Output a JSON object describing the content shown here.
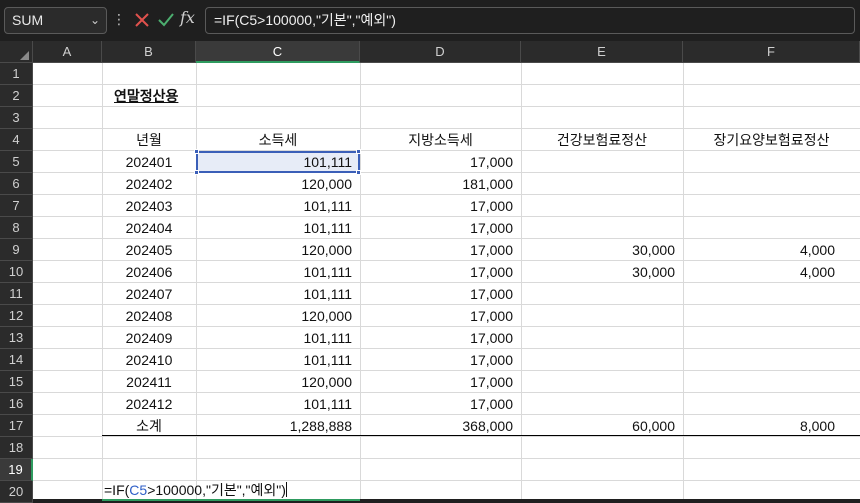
{
  "formula_bar": {
    "name_box": "SUM",
    "formula": "=IF(C5>100000,\"기본\",\"예외\")"
  },
  "columns": [
    "A",
    "B",
    "C",
    "D",
    "E",
    "F"
  ],
  "rows": [
    "1",
    "2",
    "3",
    "4",
    "5",
    "6",
    "7",
    "8",
    "9",
    "10",
    "11",
    "12",
    "13",
    "14",
    "15",
    "16",
    "17",
    "18",
    "19",
    "20"
  ],
  "sheet": {
    "title": "연말정산용",
    "headers": {
      "b": "년월",
      "c": "소득세",
      "d": "지방소득세",
      "e": "건강보험료정산",
      "f": "장기요양보험료정산"
    },
    "data_rows": [
      {
        "b": "202401",
        "c": "101,111",
        "d": "17,000",
        "e": "",
        "f": ""
      },
      {
        "b": "202402",
        "c": "120,000",
        "d": "181,000",
        "e": "",
        "f": ""
      },
      {
        "b": "202403",
        "c": "101,111",
        "d": "17,000",
        "e": "",
        "f": ""
      },
      {
        "b": "202404",
        "c": "101,111",
        "d": "17,000",
        "e": "",
        "f": ""
      },
      {
        "b": "202405",
        "c": "120,000",
        "d": "17,000",
        "e": "30,000",
        "f": "4,000"
      },
      {
        "b": "202406",
        "c": "101,111",
        "d": "17,000",
        "e": "30,000",
        "f": "4,000"
      },
      {
        "b": "202407",
        "c": "101,111",
        "d": "17,000",
        "e": "",
        "f": ""
      },
      {
        "b": "202408",
        "c": "120,000",
        "d": "17,000",
        "e": "",
        "f": ""
      },
      {
        "b": "202409",
        "c": "101,111",
        "d": "17,000",
        "e": "",
        "f": ""
      },
      {
        "b": "202410",
        "c": "101,111",
        "d": "17,000",
        "e": "",
        "f": ""
      },
      {
        "b": "202411",
        "c": "120,000",
        "d": "17,000",
        "e": "",
        "f": ""
      },
      {
        "b": "202412",
        "c": "101,111",
        "d": "17,000",
        "e": "",
        "f": ""
      }
    ],
    "totals": {
      "b": "소계",
      "c": "1,288,888",
      "d": "368,000",
      "e": "60,000",
      "f": "8,000"
    },
    "edit_cell": {
      "prefix": "=IF(",
      "ref": "C5",
      "suffix": ">100000,\"기본\",\"예외\")"
    }
  },
  "colors": {
    "accent_green": "#2e9b5f",
    "selection_blue": "#3b5fb8",
    "ref_blue": "#2f5fc7"
  }
}
